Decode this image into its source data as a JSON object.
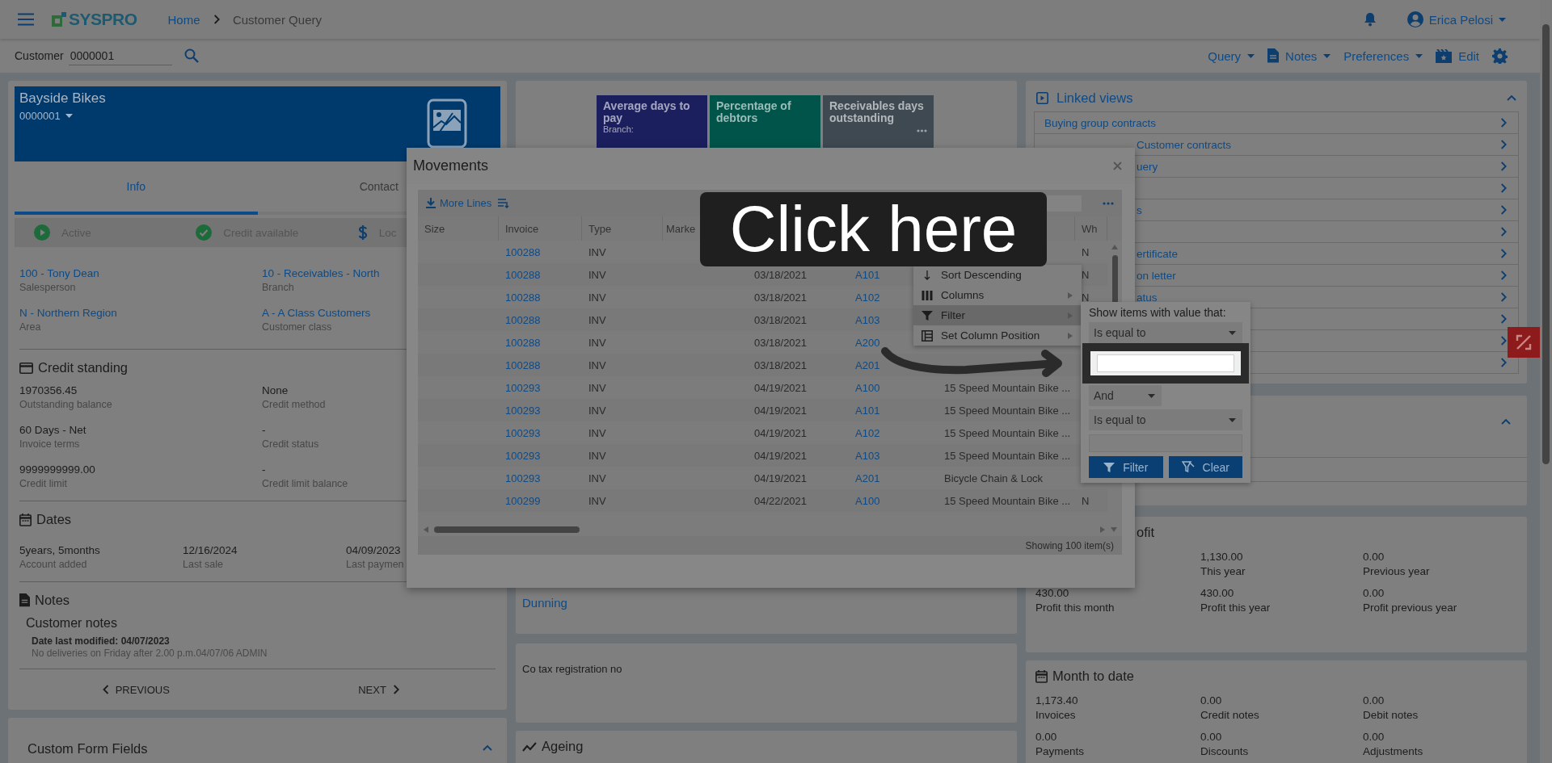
{
  "header": {
    "logo": "SYSPRO",
    "breadcrumb": [
      {
        "label": "Home",
        "kind": "link"
      },
      {
        "label": "Customer Query",
        "kind": "current"
      }
    ],
    "user": "Erica Pelosi"
  },
  "toolbar": {
    "customer_label": "Customer",
    "customer_value": "0000001",
    "actions": [
      {
        "label": "Query",
        "kind": "dropdown"
      },
      {
        "label": "Notes",
        "kind": "dropdown"
      },
      {
        "label": "Preferences",
        "kind": "dropdown"
      },
      {
        "label": "Edit",
        "kind": "button"
      }
    ]
  },
  "customer": {
    "name": "Bayside Bikes",
    "code": "0000001",
    "tabs": [
      {
        "label": "Info",
        "selected": true
      },
      {
        "label": "Contact",
        "selected": false
      }
    ],
    "statuses": [
      {
        "label": "Active",
        "kind": "play"
      },
      {
        "label": "Credit available",
        "kind": "check"
      },
      {
        "label": "Loc",
        "kind": "dollar"
      }
    ],
    "fields": [
      {
        "value": "100 - Tony Dean",
        "label": "Salesperson"
      },
      {
        "value": "10 - Receivables - North",
        "label": "Branch"
      },
      {
        "value": "N - Northern Region",
        "label": "Area"
      },
      {
        "value": "A - A Class Customers",
        "label": "Customer class"
      }
    ],
    "credit_standing": {
      "title": "Credit standing",
      "fields": [
        {
          "value": "1970356.45",
          "label": "Outstanding balance"
        },
        {
          "value": "None",
          "label": "Credit method"
        },
        {
          "value": "60 Days - Net",
          "label": "Invoice terms"
        },
        {
          "value": "-",
          "label": "Credit status"
        },
        {
          "value": "9999999999.00",
          "label": "Credit limit"
        },
        {
          "value": "-",
          "label": "Credit limit balance"
        }
      ]
    },
    "dates": {
      "title": "Dates",
      "fields": [
        {
          "value": "5years, 5months",
          "label": "Account added"
        },
        {
          "value": "12/16/2024",
          "label": "Last sale"
        },
        {
          "value": "04/09/2023",
          "label": "Last paymen"
        }
      ]
    },
    "notes": {
      "title": "Notes",
      "heading": "Customer notes",
      "modified": "Date last modified: 04/07/2023",
      "text": "No deliveries on Friday after 2.00 p.m.04/07/06 ADMIN"
    },
    "previous": "PREVIOUS",
    "next": "NEXT"
  },
  "custom_form_fields": {
    "title": "Custom Form Fields",
    "expanded": true
  },
  "kpi_tiles": [
    {
      "title": "Average days to pay",
      "subtitle": "Branch:",
      "color": "#1b1f5e"
    },
    {
      "title": "Percentage of debtors",
      "color": "#00544a"
    },
    {
      "title": "Receivables days outstanding",
      "color": "#3e4951"
    }
  ],
  "dunning": "Dunning",
  "tax": "Co tax registration no",
  "ageing": "Ageing",
  "linked_views": {
    "title": "Linked views",
    "expanded": true,
    "items": [
      {
        "kind": "link",
        "label": "Buying group contracts"
      },
      {
        "kind": "link",
        "label": "Customer contracts"
      },
      {
        "kind": "link",
        "label": "uery"
      },
      {
        "kind": "covered"
      },
      {
        "kind": "link",
        "label": "s"
      },
      {
        "kind": "covered"
      },
      {
        "kind": "link",
        "label": "ertificate"
      },
      {
        "kind": "link",
        "label": "on letter"
      },
      {
        "kind": "link",
        "label": "atus"
      },
      {
        "kind": "covered"
      },
      {
        "kind": "covered"
      },
      {
        "kind": "covered"
      }
    ]
  },
  "card_2": {
    "expanded": true
  },
  "profit": {
    "title": "ofit",
    "fields": [
      {
        "kind": "covered"
      },
      {
        "kind": "field",
        "value": "1,130.00",
        "label": "This year"
      },
      {
        "kind": "field",
        "value": "0.00",
        "label": "Previous year"
      },
      {
        "kind": "field",
        "value": "430.00",
        "label": "Profit this month"
      },
      {
        "kind": "field",
        "value": "430.00",
        "label": "Profit this year"
      },
      {
        "kind": "field",
        "value": "0.00",
        "label": "Profit previous year"
      }
    ]
  },
  "month_to_date": {
    "title": "Month to date",
    "fields": [
      {
        "value": "1,173.40",
        "label": "Invoices"
      },
      {
        "value": "0.00",
        "label": "Credit notes"
      },
      {
        "value": "0.00",
        "label": "Debit notes"
      },
      {
        "value": "0.00",
        "label": "Payments"
      },
      {
        "value": "0.00",
        "label": "Discounts"
      },
      {
        "value": "0.00",
        "label": "Adjustments"
      }
    ]
  },
  "movements": {
    "title": "Movements",
    "more_lines": "More Lines",
    "columns": {
      "size": "Size",
      "invoice": "Invoice",
      "type": "Type",
      "column_4": "Marke",
      "wh": "Wh"
    },
    "rows": [
      {
        "invoice": "100288",
        "type": "INV",
        "wh": "N"
      },
      {
        "invoice": "100288",
        "type": "INV",
        "column_5": "03/18/2021",
        "column_6": "A101",
        "wh": "N"
      },
      {
        "invoice": "100288",
        "type": "INV",
        "column_5": "03/18/2021",
        "column_6": "A102",
        "wh": "N"
      },
      {
        "invoice": "100288",
        "type": "INV",
        "column_5": "03/18/2021",
        "column_6": "A103"
      },
      {
        "invoice": "100288",
        "type": "INV",
        "column_5": "03/18/2021",
        "column_6": "A200"
      },
      {
        "invoice": "100288",
        "type": "INV",
        "column_5": "03/18/2021",
        "column_6": "A201"
      },
      {
        "invoice": "100293",
        "type": "INV",
        "column_5": "04/19/2021",
        "column_6": "A100",
        "column_7": "15 Speed Mountain Bike ..."
      },
      {
        "invoice": "100293",
        "type": "INV",
        "column_5": "04/19/2021",
        "column_6": "A101",
        "column_7": "15 Speed Mountain Bike ..."
      },
      {
        "invoice": "100293",
        "type": "INV",
        "column_5": "04/19/2021",
        "column_6": "A102",
        "column_7": "15 Speed Mountain Bike ..."
      },
      {
        "invoice": "100293",
        "type": "INV",
        "column_5": "04/19/2021",
        "column_6": "A103",
        "column_7": "15 Speed Mountain Bike ..."
      },
      {
        "invoice": "100293",
        "type": "INV",
        "column_5": "04/19/2021",
        "column_6": "A201",
        "column_7": "Bicycle Chain & Lock"
      },
      {
        "invoice": "100299",
        "type": "INV",
        "column_5": "04/22/2021",
        "column_6": "A100",
        "column_7": "15 Speed Mountain Bike ...",
        "wh": "N"
      }
    ],
    "footer": "Showing 100 item(s)",
    "menu": [
      {
        "label": "Sort Descending",
        "kind": "sort",
        "submenu": false,
        "selected": false
      },
      {
        "label": "Columns",
        "kind": "columns",
        "submenu": true,
        "selected": false
      },
      {
        "label": "Filter",
        "kind": "filter",
        "submenu": true,
        "selected": true
      },
      {
        "label": "Set Column Position",
        "kind": "position",
        "submenu": true,
        "selected": false
      }
    ]
  },
  "filter_popup": {
    "prompt": "Show items with value that:",
    "operator_1": "Is equal to",
    "logic": "And",
    "operator_2": "Is equal to",
    "buttons": [
      {
        "label": "Filter",
        "kind": "filter"
      },
      {
        "label": "Clear",
        "kind": "clear"
      }
    ]
  },
  "callout": "Click here"
}
